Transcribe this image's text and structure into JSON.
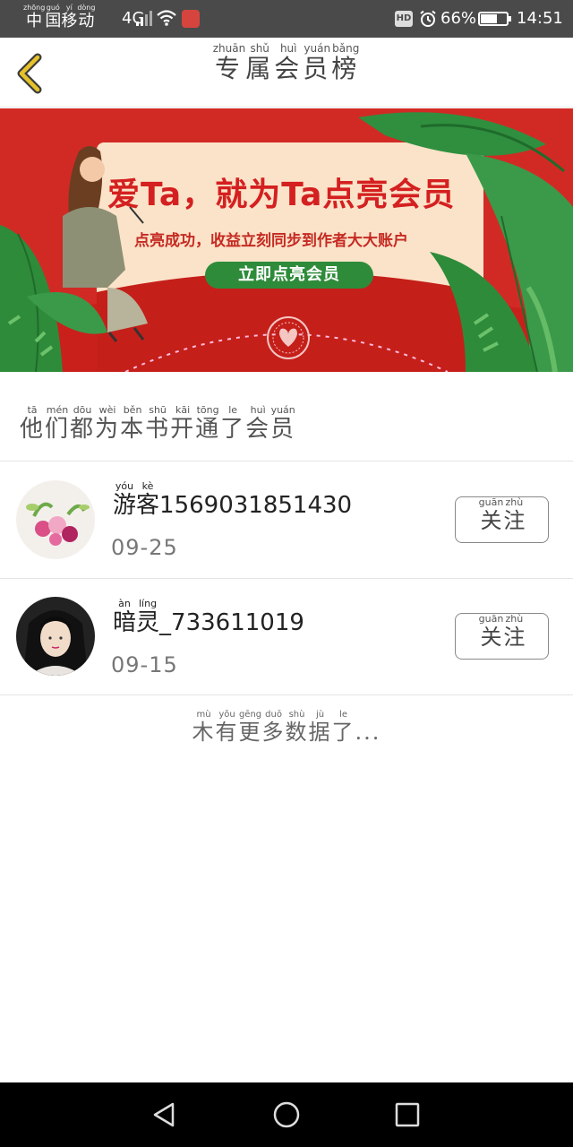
{
  "status_bar": {
    "carrier": [
      {
        "char": "中",
        "pinyin": "zhōng"
      },
      {
        "char": "国",
        "pinyin": "guó"
      },
      {
        "char": "移",
        "pinyin": "yí"
      },
      {
        "char": "动",
        "pinyin": "dòng"
      }
    ],
    "network": "4G",
    "battery": "66%",
    "battery_level": 0.66,
    "time": "14:51",
    "hd": "HD"
  },
  "header": {
    "title": [
      {
        "char": "专",
        "pinyin": "zhuān"
      },
      {
        "char": "属",
        "pinyin": "shǔ"
      },
      {
        "char": "会",
        "pinyin": "huì"
      },
      {
        "char": "员",
        "pinyin": "yuán"
      },
      {
        "char": "榜",
        "pinyin": "bǎng"
      }
    ],
    "back_icon": "chevron-left-icon"
  },
  "banner": {
    "headline": "爱Ta，就为Ta点亮会员",
    "subtitle": "点亮成功，收益立刻同步到作者大大账户",
    "cta": "立即点亮会员"
  },
  "section": {
    "title": [
      {
        "char": "他",
        "pinyin": "tā"
      },
      {
        "char": "们",
        "pinyin": "mén"
      },
      {
        "char": "都",
        "pinyin": "dōu"
      },
      {
        "char": "为",
        "pinyin": "wèi"
      },
      {
        "char": "本",
        "pinyin": "běn"
      },
      {
        "char": "书",
        "pinyin": "shū"
      },
      {
        "char": "开",
        "pinyin": "kāi"
      },
      {
        "char": "通",
        "pinyin": "tōng"
      },
      {
        "char": "了",
        "pinyin": "le"
      },
      {
        "char": "会",
        "pinyin": "huì"
      },
      {
        "char": "员",
        "pinyin": "yuán"
      }
    ]
  },
  "members": [
    {
      "name_cn": [
        {
          "char": "游",
          "pinyin": "yóu"
        },
        {
          "char": "客",
          "pinyin": "kè"
        }
      ],
      "name_suffix": "1569031851430",
      "date": "09-25",
      "follow": [
        {
          "char": "关",
          "pinyin": "guān"
        },
        {
          "char": "注",
          "pinyin": "zhù"
        }
      ]
    },
    {
      "name_cn": [
        {
          "char": "暗",
          "pinyin": "àn"
        },
        {
          "char": "灵",
          "pinyin": "líng"
        }
      ],
      "name_suffix": "_733611019",
      "date": "09-15",
      "follow": [
        {
          "char": "关",
          "pinyin": "guān"
        },
        {
          "char": "注",
          "pinyin": "zhù"
        }
      ]
    }
  ],
  "footer_note": [
    {
      "char": "木",
      "pinyin": "mù"
    },
    {
      "char": "有",
      "pinyin": "yǒu"
    },
    {
      "char": "更",
      "pinyin": "gēng"
    },
    {
      "char": "多",
      "pinyin": "duō"
    },
    {
      "char": "数",
      "pinyin": "shù"
    },
    {
      "char": "据",
      "pinyin": "jù"
    },
    {
      "char": "了",
      "pinyin": "le"
    },
    {
      "char": "...",
      "pinyin": ""
    }
  ],
  "colors": {
    "banner_red": "#d12a25",
    "cta_green": "#2e8b3a",
    "back_yellow": "#e6c229"
  }
}
